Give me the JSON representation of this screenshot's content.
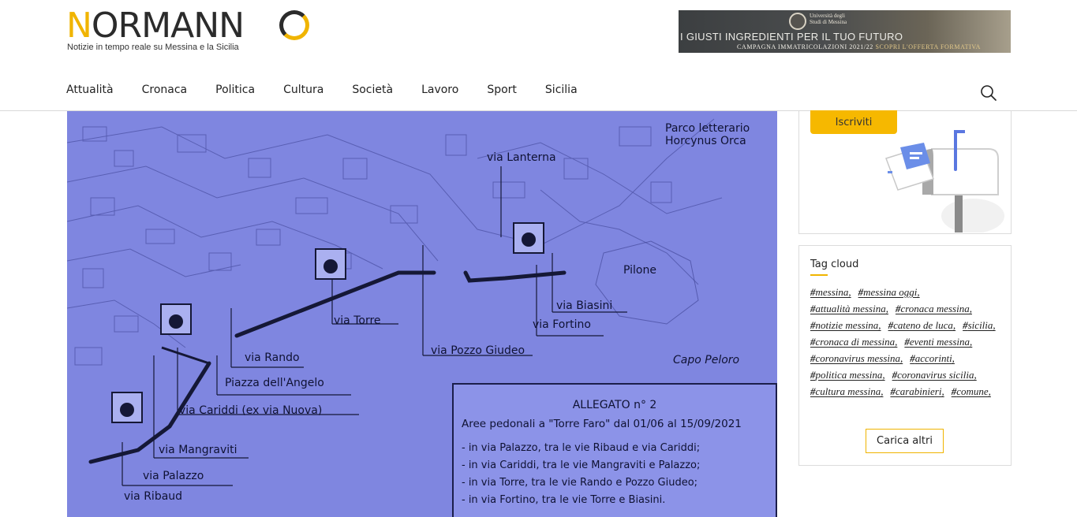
{
  "brand": {
    "logo_text_first": "N",
    "logo_text_rest": "ORMANN",
    "tagline": "Notizie in tempo reale su Messina e la Sicilia",
    "accent_color": "#f0b400"
  },
  "banner": {
    "university": "Università degli Studi di Messina",
    "headline": "I GIUSTI INGREDIENTI PER IL TUO FUTURO",
    "campaign": "CAMPAGNA IMMATRICOLAZIONI 2021/22",
    "cta": "SCOPRI L'OFFERTA FORMATIVA"
  },
  "nav": {
    "items": [
      "Attualità",
      "Cronaca",
      "Politica",
      "Cultura",
      "Società",
      "Lavoro",
      "Sport",
      "Sicilia"
    ],
    "search_icon": "search-icon"
  },
  "map": {
    "labels": {
      "parco": "Parco letterario Horcynus Orca",
      "lanterna": "via Lanterna",
      "pilone": "Pilone",
      "biasini": "via Biasini",
      "fortino": "via Fortino",
      "torre": "via Torre",
      "pozzo": "via Pozzo Giudeo",
      "rando": "via Rando",
      "piazza": "Piazza dell'Angelo",
      "cariddi": "via Cariddi (ex via Nuova)",
      "mangraviti": "via Mangraviti",
      "palazzo": "via Palazzo",
      "ribaud": "via Ribaud",
      "capo": "Capo Peloro"
    },
    "allegato": {
      "title": "ALLEGATO n° 2",
      "subtitle": "Aree pedonali a \"Torre Faro\" dal 01/06 al 15/09/2021",
      "lines": [
        "- in via Palazzo, tra le vie Ribaud e via Cariddi;",
        "- in via Cariddi, tra le vie Mangraviti e Palazzo;",
        "- in via Torre, tra le vie Rando e Pozzo Giudeo;",
        "- in via Fortino, tra le vie Torre e Biasini."
      ]
    }
  },
  "sidebar": {
    "subscribe_label": "Iscriviti",
    "tag_cloud_title": "Tag cloud",
    "tags": [
      "messina",
      "messina oggi",
      "attualità messina",
      "cronaca messina",
      "notizie messina",
      "cateno de luca",
      "sicilia",
      "cronaca di messina",
      "eventi messina",
      "coronavirus messina",
      "accorinti",
      "politica messina",
      "coronavirus sicilia",
      "cultura messina",
      "carabinieri",
      "comune"
    ],
    "load_more_label": "Carica altri"
  }
}
